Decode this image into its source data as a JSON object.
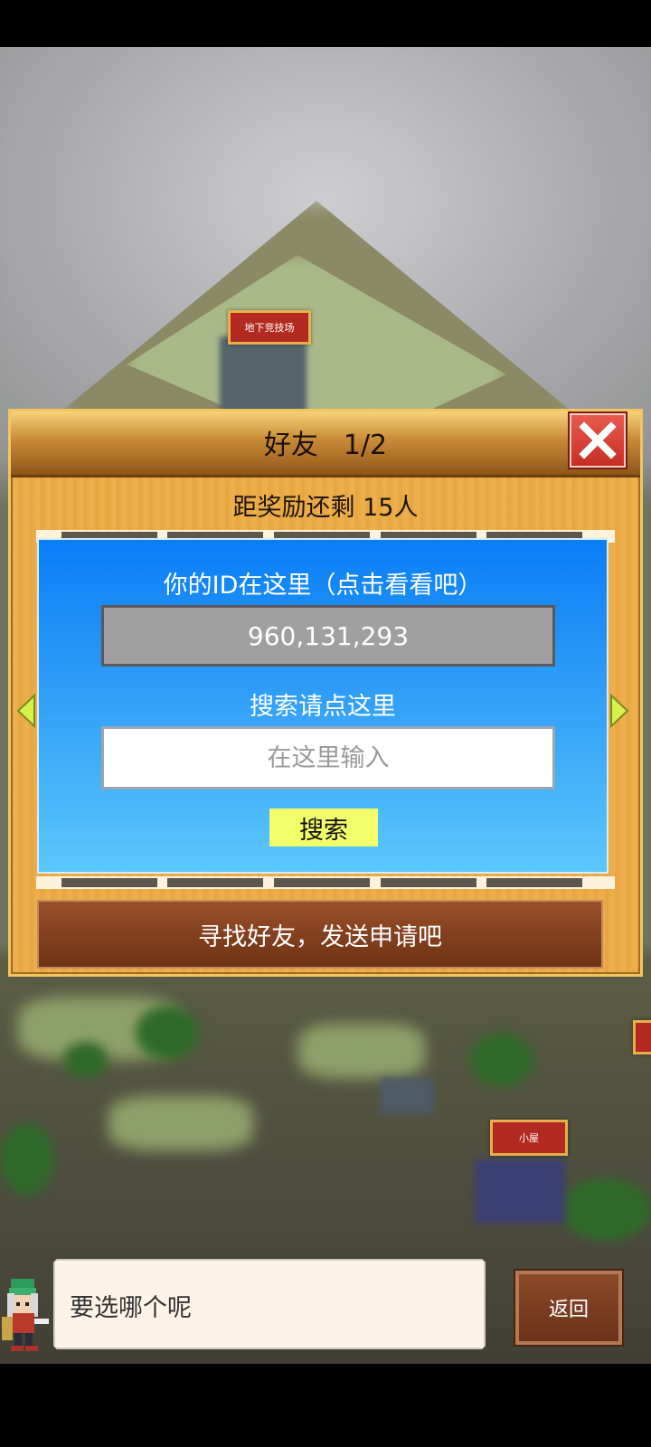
{
  "world": {
    "signs": [
      {
        "label": "地下竞技场"
      },
      {
        "label": "小屋"
      }
    ]
  },
  "dialog": {
    "title": "好友",
    "page": "1/2",
    "reward_text": "距奖励还剩 15人",
    "id_prompt": "你的ID在这里（点击看看吧）",
    "user_id": "960,131,293",
    "search_prompt": "搜索请点这里",
    "search_placeholder": "在这里输入",
    "search_button": "搜索",
    "find_button": "寻找好友，发送申请吧"
  },
  "chat": {
    "message": "要选哪个呢"
  },
  "back_button": "返回",
  "colors": {
    "panel_blue": "#0a7ef8",
    "close_red": "#d6392e",
    "search_yellow": "#f2ff6a",
    "wood": "#e9a944"
  }
}
